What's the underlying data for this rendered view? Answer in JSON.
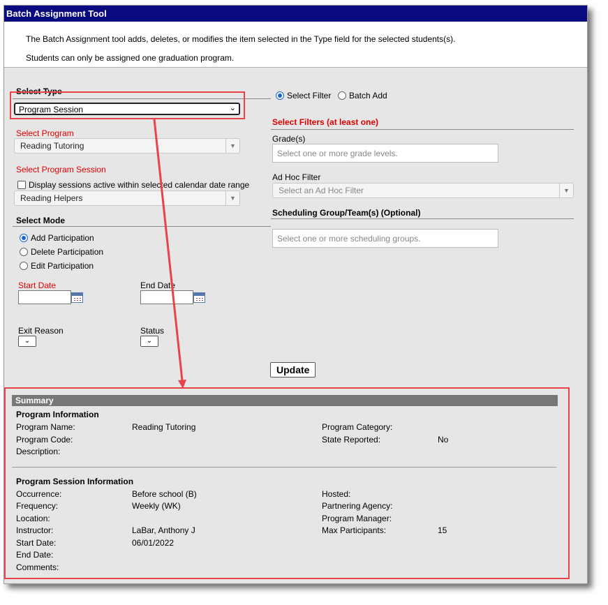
{
  "title": "Batch Assignment Tool",
  "intro": {
    "line1": "The Batch Assignment tool adds, deletes, or modifies the item selected in the Type field for the selected students(s).",
    "line2": "Students can only be assigned one graduation program."
  },
  "select_type": {
    "label": "Select Type",
    "value": "Program Session"
  },
  "filter_mode": {
    "select_filter": "Select Filter",
    "batch_add": "Batch Add",
    "selected": "select_filter"
  },
  "filters": {
    "heading": "Select Filters (at least one)",
    "grades_label": "Grade(s)",
    "grades_placeholder": "Select one or more grade levels.",
    "adhoc_label": "Ad Hoc Filter",
    "adhoc_placeholder": "Select an Ad Hoc Filter",
    "scheduling_heading": "Scheduling Group/Team(s) (Optional)",
    "scheduling_placeholder": "Select one or more scheduling groups."
  },
  "program": {
    "label": "Select Program",
    "value": "Reading Tutoring"
  },
  "session": {
    "label": "Select Program Session",
    "checkbox_label": "Display sessions active within selected calendar date range",
    "value": "Reading Helpers"
  },
  "mode": {
    "label": "Select Mode",
    "options": [
      "Add Participation",
      "Delete Participation",
      "Edit Participation"
    ],
    "selected_index": 0
  },
  "dates": {
    "start_label": "Start Date",
    "end_label": "End Date"
  },
  "exit_reason_label": "Exit Reason",
  "status_label": "Status",
  "update_button": "Update",
  "summary": {
    "header": "Summary",
    "program_info_heading": "Program Information",
    "program_name_label": "Program Name:",
    "program_name": "Reading Tutoring",
    "program_code_label": "Program Code:",
    "description_label": "Description:",
    "program_category_label": "Program Category:",
    "state_reported_label": "State Reported:",
    "state_reported": "No",
    "session_info_heading": "Program Session Information",
    "occurrence_label": "Occurrence:",
    "occurrence": "Before school (B)",
    "frequency_label": "Frequency:",
    "frequency": "Weekly (WK)",
    "location_label": "Location:",
    "instructor_label": "Instructor:",
    "instructor": "LaBar, Anthony J",
    "start_date_label": "Start Date:",
    "start_date": "06/01/2022",
    "end_date_label": "End Date:",
    "comments_label": "Comments:",
    "hosted_label": "Hosted:",
    "partnering_label": "Partnering Agency:",
    "manager_label": "Program Manager:",
    "max_participants_label": "Max Participants:",
    "max_participants": "15"
  },
  "colors": {
    "title_bar": "#0a0a80",
    "required_label": "#e00000",
    "annotation": "#e8434a",
    "summary_bar": "#777777"
  }
}
